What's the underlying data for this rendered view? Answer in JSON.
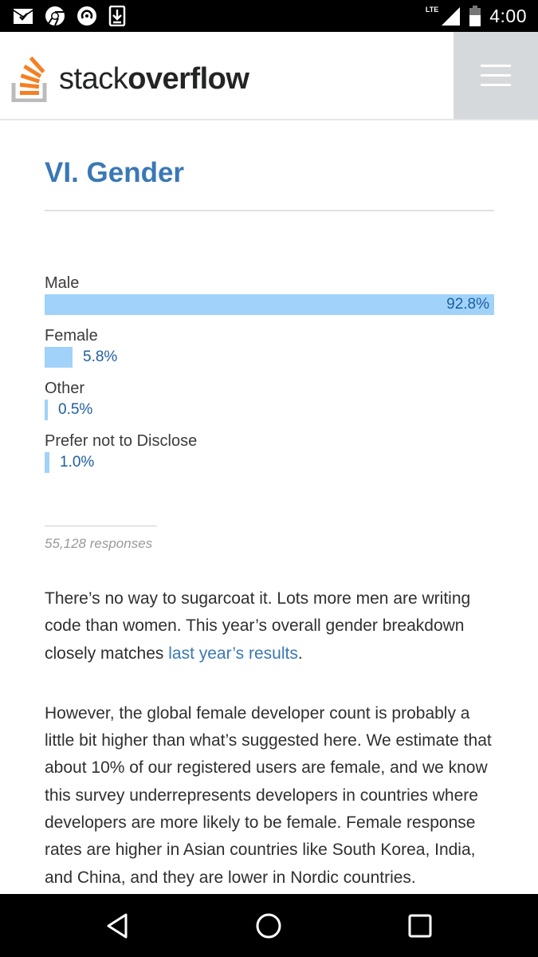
{
  "status_bar": {
    "time": "4:00",
    "network": "LTE",
    "icons_left": [
      "mail-check-icon",
      "chrome-icon",
      "sync-icon",
      "download-icon"
    ],
    "icons_right": [
      "signal-icon",
      "battery-icon"
    ]
  },
  "header": {
    "logo_text_light": "stack",
    "logo_text_bold": "overflow",
    "menu_icon": "hamburger-menu-icon",
    "logo_colors": [
      "#f48024",
      "#bcbbbb"
    ]
  },
  "section": {
    "title": "VI. Gender"
  },
  "chart_data": {
    "type": "bar",
    "orientation": "horizontal",
    "categories": [
      "Male",
      "Female",
      "Other",
      "Prefer not to Disclose"
    ],
    "values": [
      92.8,
      5.8,
      0.5,
      1.0
    ],
    "value_labels": [
      "92.8%",
      "5.8%",
      "0.5%",
      "1.0%"
    ],
    "unit": "%",
    "bar_color": "#a0d2fa",
    "label_color": "#1f5fa0"
  },
  "responses": "55,128 responses",
  "paragraphs": {
    "p1_text": "There’s no way to sugarcoat it. Lots more men are writing code than women. This year’s overall gender breakdown closely matches ",
    "p1_link": "last year’s results",
    "p1_end": ".",
    "p2_text": "However, the global female developer count is probably a little bit higher than what’s suggested here. We estimate that about 10% of our registered users are female, and we know this survey underrepresents developers in countries where developers are more likely to be female. Female response rates are higher in Asian countries like South Korea, India, and China, and they are lower in Nordic countries."
  },
  "nav_bar": {
    "buttons": [
      "back-icon",
      "home-icon",
      "recents-icon"
    ]
  }
}
